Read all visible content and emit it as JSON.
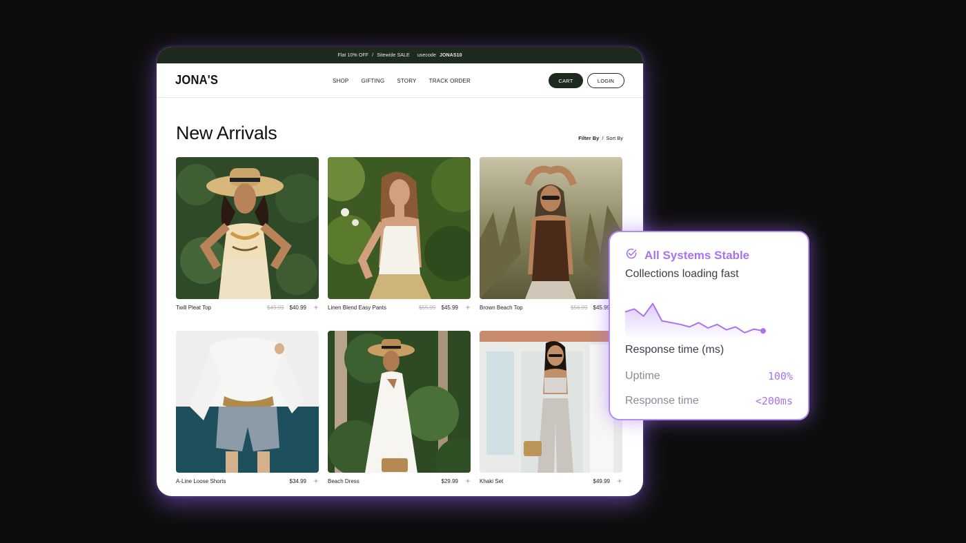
{
  "colors": {
    "accent": "#a873ef",
    "dark_green": "#1f2a1e",
    "background": "#0d0d0d"
  },
  "promo": {
    "offer": "Flat 10% OFF",
    "separator": "/",
    "sale": "Sitewide SALE",
    "code_prefix": "usecode",
    "code": "JONAS10"
  },
  "nav": {
    "logo": "JONA'S",
    "items": [
      "SHOP",
      "GIFTING",
      "STORY",
      "TRACK ORDER"
    ],
    "cart_label": "CART",
    "login_label": "LOGIN"
  },
  "page": {
    "title": "New Arrivals",
    "filter_label": "Filter By",
    "separator": "/",
    "sort_label": "Sort By"
  },
  "products": [
    {
      "name": "Twill Pleat Top",
      "old_price": "$49.99",
      "price": "$40.99",
      "add": "+"
    },
    {
      "name": "Linen Blend Easy Pants",
      "old_price": "$55.99",
      "price": "$45.99",
      "add": "+"
    },
    {
      "name": "Brown Beach Top",
      "old_price": "$56.99",
      "price": "$45.99",
      "add": "+"
    },
    {
      "name": "A-Line Loose Shorts",
      "old_price": "",
      "price": "$34.99",
      "add": "+"
    },
    {
      "name": "Beach Dress",
      "old_price": "",
      "price": "$29.99",
      "add": "+"
    },
    {
      "name": "Khaki Set",
      "old_price": "",
      "price": "$49.99",
      "add": "+"
    }
  ],
  "status": {
    "icon": "check-circle-icon",
    "title": "All Systems Stable",
    "subtitle": "Collections loading fast",
    "chart_label": "Response time (ms)",
    "uptime_label": "Uptime",
    "uptime_value": "100%",
    "response_label": "Response time",
    "response_value": "<200ms"
  },
  "chart_data": {
    "type": "area",
    "title": "",
    "xlabel": "",
    "ylabel": "Response time (ms)",
    "series": [
      {
        "values": [
          0.7,
          0.78,
          0.58,
          0.93,
          0.45,
          0.4,
          0.35,
          0.28,
          0.4,
          0.25,
          0.35,
          0.2,
          0.28,
          0.12,
          0.22,
          0.17
        ]
      }
    ]
  }
}
